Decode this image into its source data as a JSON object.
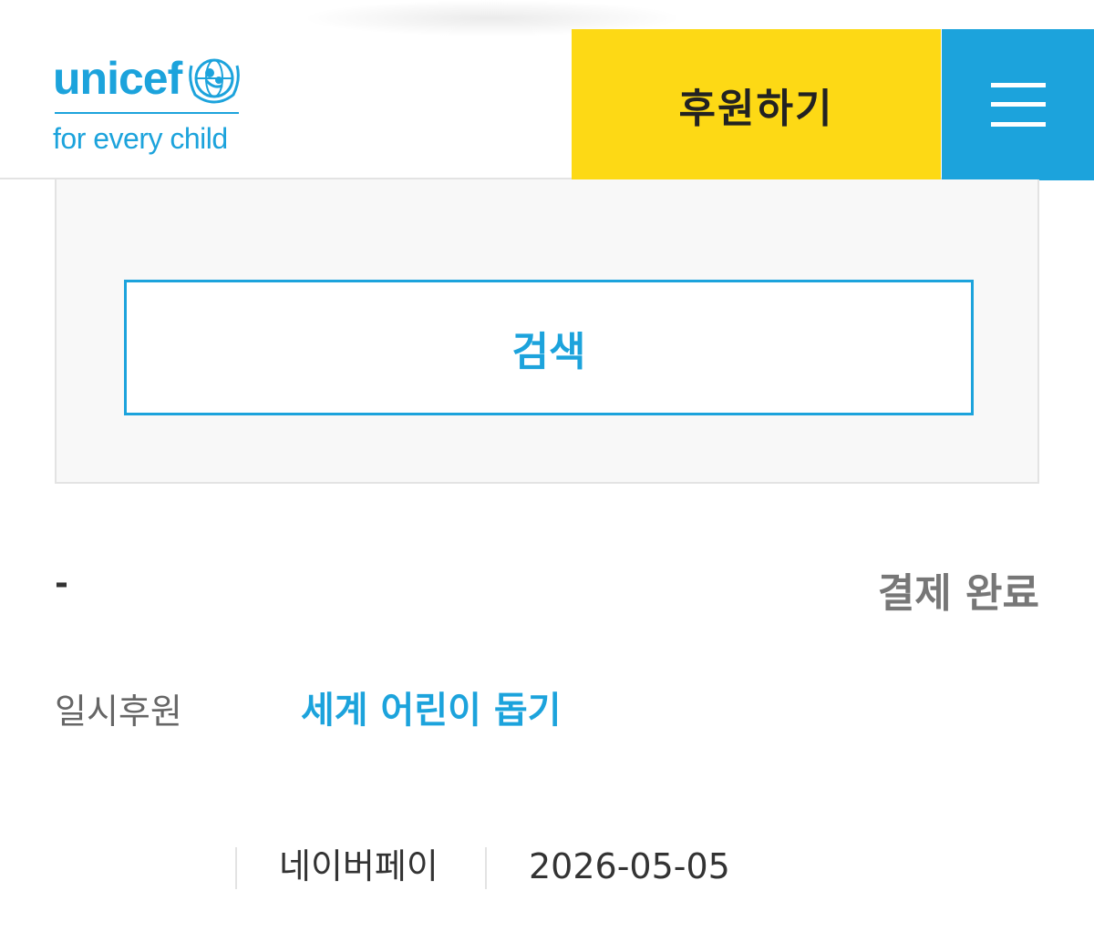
{
  "header": {
    "logo_word": "unicef",
    "logo_tagline": "for every child",
    "donate_label": "후원하기",
    "menu_icon": "hamburger-menu-icon",
    "colors": {
      "brand_blue": "#1ca3dc",
      "donate_yellow": "#fdd915"
    }
  },
  "search": {
    "button_label": "검색"
  },
  "result": {
    "dash": "-",
    "status": "결제 완료",
    "type": "일시후원",
    "campaign": "세계 어린이 돕기",
    "payment_method": "네이버페이",
    "date": "2026-05-05"
  }
}
